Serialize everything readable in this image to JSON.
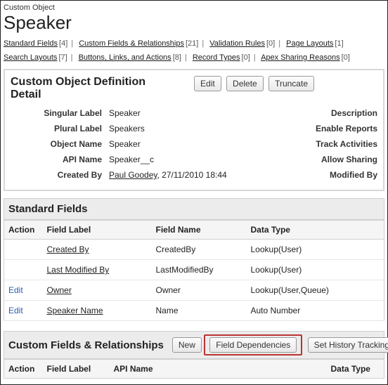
{
  "header": {
    "eyebrow": "Custom Object",
    "title": "Speaker"
  },
  "tabs": [
    {
      "label": "Standard Fields",
      "count": "[4]"
    },
    {
      "label": "Custom Fields & Relationships",
      "count": "[21]"
    },
    {
      "label": "Validation Rules",
      "count": "[0]"
    },
    {
      "label": "Page Layouts",
      "count": "[1]"
    },
    {
      "label": "Search Layouts",
      "count": "[7]"
    },
    {
      "label": "Buttons, Links, and Actions",
      "count": "[8]"
    },
    {
      "label": "Record Types",
      "count": "[0]"
    },
    {
      "label": "Apex Sharing Reasons",
      "count": "[0]"
    }
  ],
  "detail": {
    "title": "Custom Object Definition Detail",
    "buttons": {
      "edit": "Edit",
      "delete": "Delete",
      "truncate": "Truncate"
    },
    "rows": {
      "singular": {
        "k": "Singular Label",
        "v": "Speaker",
        "r": "Description"
      },
      "plural": {
        "k": "Plural Label",
        "v": "Speakers",
        "r": "Enable Reports"
      },
      "objname": {
        "k": "Object Name",
        "v": "Speaker",
        "r": "Track Activities"
      },
      "apiname": {
        "k": "API Name",
        "v": "Speaker__c",
        "r": "Allow Sharing"
      },
      "createdby": {
        "k": "Created By",
        "who": "Paul Goodey",
        "when": ", 27/11/2010 18:44",
        "r": "Modified By"
      }
    }
  },
  "std": {
    "title": "Standard Fields",
    "cols": {
      "action": "Action",
      "label": "Field Label",
      "name": "Field Name",
      "type": "Data Type"
    },
    "rows": [
      {
        "action": "",
        "label": "Created By",
        "name": "CreatedBy",
        "type": "Lookup(User)"
      },
      {
        "action": "",
        "label": "Last Modified By",
        "name": "LastModifiedBy",
        "type": "Lookup(User)"
      },
      {
        "action": "Edit",
        "label": "Owner",
        "name": "Owner",
        "type": "Lookup(User,Queue)"
      },
      {
        "action": "Edit",
        "label": "Speaker Name",
        "name": "Name",
        "type": "Auto Number"
      }
    ]
  },
  "cfr": {
    "title": "Custom Fields & Relationships",
    "buttons": {
      "new": "New",
      "deps": "Field Dependencies",
      "hist": "Set History Tracking"
    },
    "cols": {
      "action": "Action",
      "label": "Field Label",
      "api": "API Name",
      "type": "Data Type"
    }
  }
}
